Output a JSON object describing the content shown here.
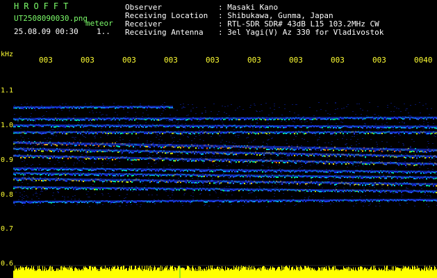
{
  "header": {
    "brand": "HROFFT",
    "filename": "UT2508090030.png",
    "tag": "meteor",
    "datetime": "25.08.09 00:30",
    "counter": "1.."
  },
  "info": {
    "labels": [
      "Observer",
      "Receiving Location",
      "Receiver",
      "Receiving Antenna"
    ],
    "values": [
      ": Masaki Kano",
      ": Shibukawa, Gunma, Japan",
      ": RTL-SDR SDR# 43dB L15 103.2MHz CW",
      ": 3el Yagi(V) Az 330 for Vladivostok"
    ]
  },
  "axis": {
    "unit": "kHz",
    "x_ticks": [
      "003",
      "003",
      "003",
      "003",
      "003",
      "003",
      "003",
      "003",
      "003",
      "0040"
    ],
    "y_ticks": [
      "1.1",
      "1.0",
      "0.9",
      "0.8",
      "0.7",
      "0.6"
    ]
  },
  "colors": {
    "text_green": "#7cfc6a",
    "axis_yellow": "#ffff33",
    "signal_blue": "#1b3cff"
  }
}
